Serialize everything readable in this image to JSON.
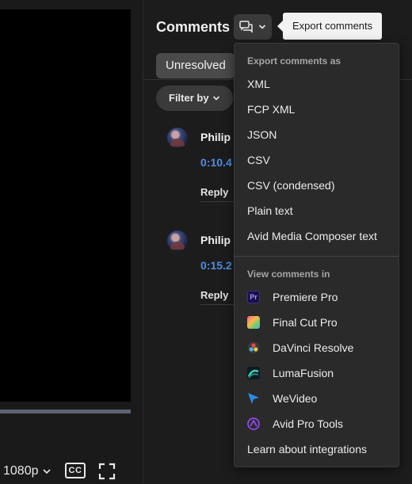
{
  "player": {
    "quality_label": "1080p",
    "cc_label": "CC"
  },
  "comments": {
    "title": "Comments",
    "tooltip": "Export comments",
    "tab_unresolved": "Unresolved",
    "filter_label": "Filter by",
    "items": [
      {
        "author": "Philip",
        "timecode": "0:10.4",
        "reply_label": "Reply"
      },
      {
        "author": "Philip",
        "timecode": "0:15.2",
        "reply_label": "Reply"
      }
    ]
  },
  "export_menu": {
    "export_heading": "Export comments as",
    "export_options": [
      "XML",
      "FCP XML",
      "JSON",
      "CSV",
      "CSV (condensed)",
      "Plain text",
      "Avid Media Composer text"
    ],
    "view_heading": "View comments in",
    "apps": [
      {
        "label": "Premiere Pro",
        "icon": "premiere-pro-icon"
      },
      {
        "label": "Final Cut Pro",
        "icon": "final-cut-pro-icon"
      },
      {
        "label": "DaVinci Resolve",
        "icon": "davinci-resolve-icon"
      },
      {
        "label": "LumaFusion",
        "icon": "lumafusion-icon"
      },
      {
        "label": "WeVideo",
        "icon": "wevideo-icon"
      },
      {
        "label": "Avid Pro Tools",
        "icon": "avid-pro-tools-icon"
      }
    ],
    "learn_more": "Learn about integrations"
  },
  "colors": {
    "background": "#1c1c1c",
    "menu_bg": "#2a2a2a",
    "timecode": "#4d8ee8",
    "tooltip_bg": "#f2f2f2"
  }
}
